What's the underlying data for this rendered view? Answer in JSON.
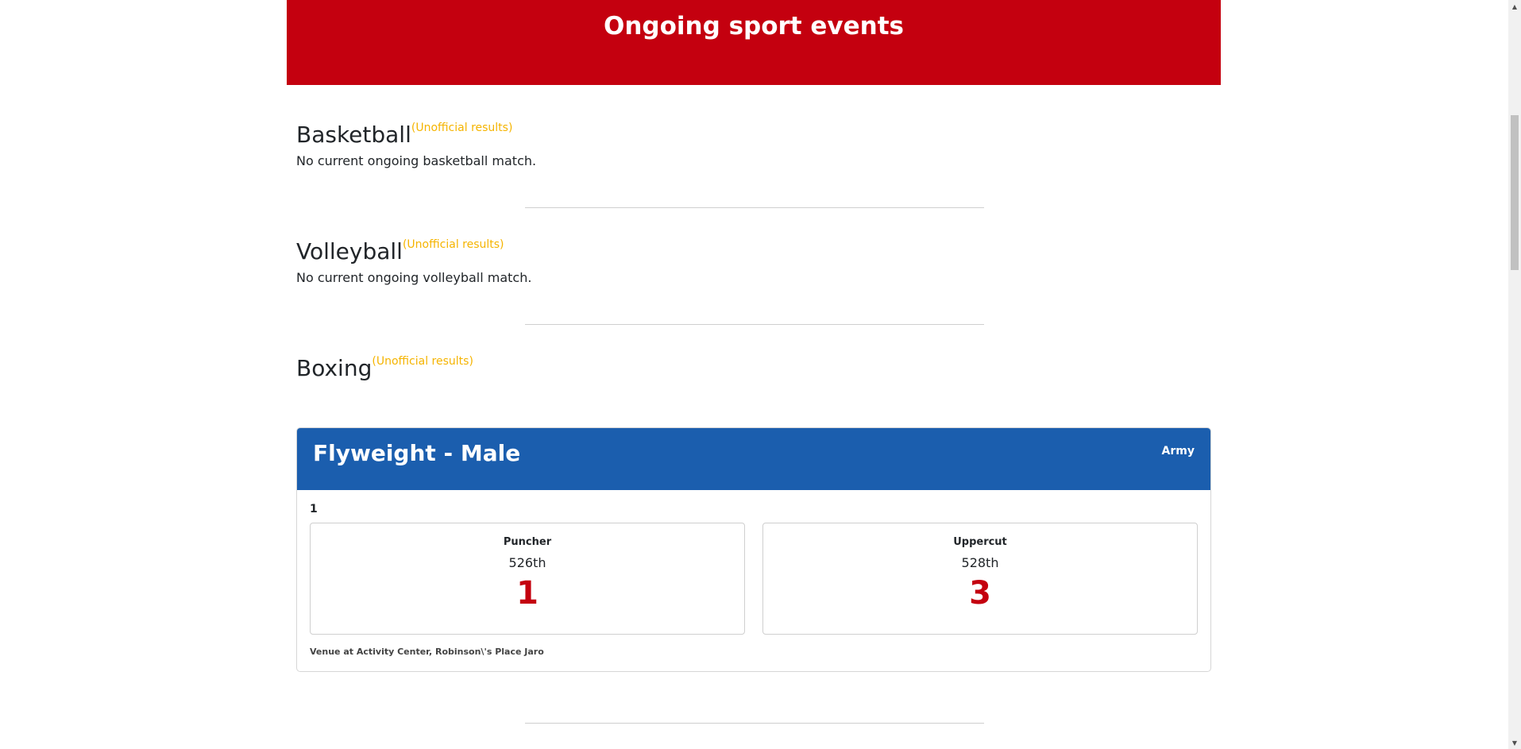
{
  "header": {
    "title": "Ongoing sport events",
    "color": "#c4000f"
  },
  "basketball": {
    "title": "Basketball",
    "badge": "(Unofficial results)",
    "status": "No current ongoing basketball match."
  },
  "volleyball": {
    "title": "Volleyball",
    "badge": "(Unofficial results)",
    "status": "No current ongoing volleyball match."
  },
  "boxing": {
    "title": "Boxing",
    "badge": "(Unofficial results)",
    "match": {
      "division": "Flyweight - Male",
      "organizer": "Army",
      "round": "1",
      "venue": "Venue at Activity Center, Robinson\\'s Place Jaro",
      "boxers": [
        {
          "name": "Puncher",
          "team": "526th",
          "score": "1"
        },
        {
          "name": "Uppercut",
          "team": "528th",
          "score": "3"
        }
      ],
      "header_color": "#1b5eae"
    }
  },
  "colors": {
    "badge": "#f5b400",
    "score": "#c4000f"
  }
}
